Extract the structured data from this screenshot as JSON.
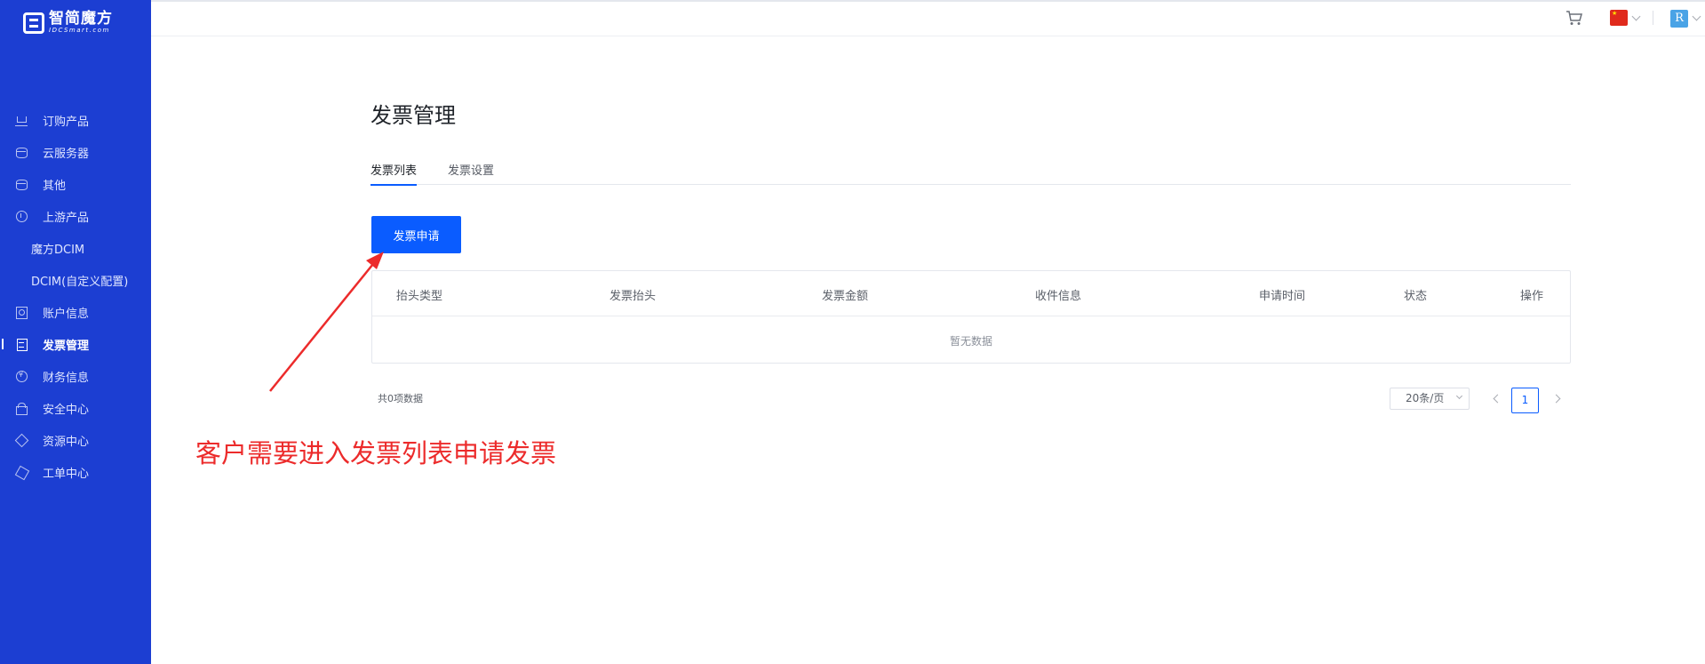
{
  "brand": {
    "name": "智简魔方",
    "sub": "IDCSmart.com"
  },
  "sidebar": {
    "items": [
      {
        "label": "订购产品",
        "icon": "cart-icon"
      },
      {
        "label": "云服务器",
        "icon": "database-icon"
      },
      {
        "label": "其他",
        "icon": "database-icon"
      },
      {
        "label": "上游产品",
        "icon": "info-circle-icon"
      },
      {
        "label": "魔方DCIM",
        "icon": ""
      },
      {
        "label": "DCIM(自定义配置)",
        "icon": ""
      },
      {
        "label": "账户信息",
        "icon": "user-card-icon"
      },
      {
        "label": "发票管理",
        "icon": "invoice-icon",
        "active": true
      },
      {
        "label": "财务信息",
        "icon": "money-icon"
      },
      {
        "label": "安全中心",
        "icon": "lock-icon"
      },
      {
        "label": "资源中心",
        "icon": "tag-icon"
      },
      {
        "label": "工单中心",
        "icon": "box-icon"
      }
    ]
  },
  "topbar": {
    "avatar_letter": "R",
    "language_flag": "cn-flag-icon"
  },
  "page": {
    "title": "发票管理",
    "tabs": [
      {
        "label": "发票列表",
        "active": true
      },
      {
        "label": "发票设置",
        "active": false
      }
    ],
    "apply_button": "发票申请"
  },
  "table": {
    "columns": [
      "抬头类型",
      "发票抬头",
      "发票金额",
      "收件信息",
      "申请时间",
      "状态",
      "操作"
    ],
    "empty_text": "暂无数据"
  },
  "pagination": {
    "total_text": "共0项数据",
    "page_size": "20条/页",
    "current_page": "1"
  },
  "annotation": {
    "text": "客户需要进入发票列表申请发票",
    "color": "#ec2b2b"
  },
  "colors": {
    "sidebar": "#1c3ed2",
    "primary": "#0a5cff"
  }
}
